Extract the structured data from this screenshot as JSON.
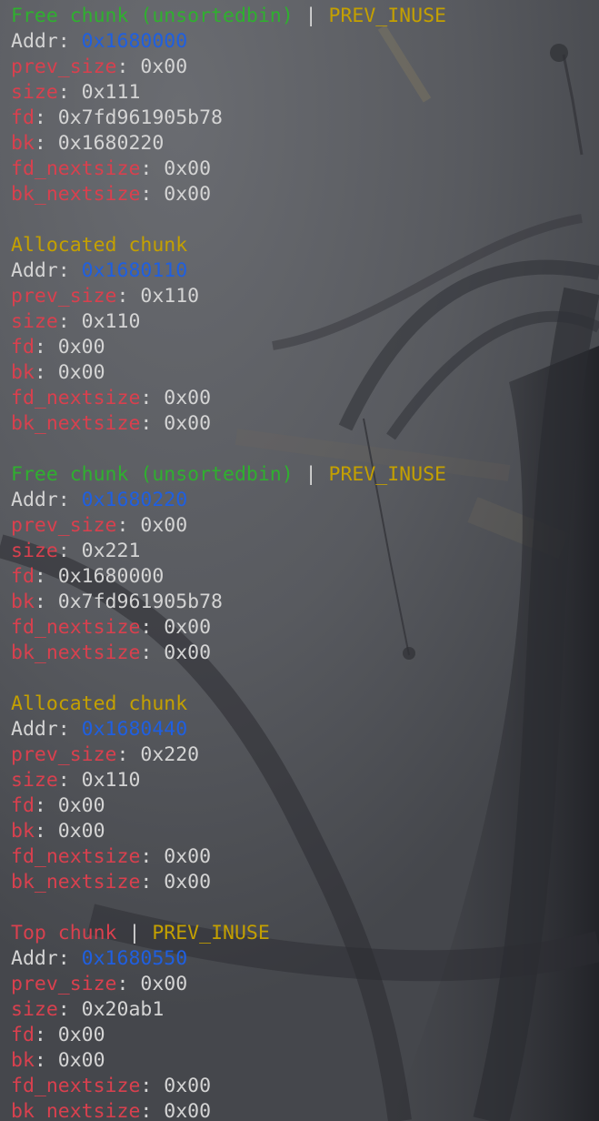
{
  "terminal": {
    "chunks": [
      {
        "header": "Free chunk (unsortedbin)",
        "flag": "PREV_INUSE",
        "kind": "free",
        "addr_label": "Addr",
        "addr": "0x1680000",
        "fields": [
          {
            "key": "prev_size",
            "value": "0x00"
          },
          {
            "key": "size",
            "value": "0x111"
          },
          {
            "key": "fd",
            "value": "0x7fd961905b78"
          },
          {
            "key": "bk",
            "value": "0x1680220"
          },
          {
            "key": "fd_nextsize",
            "value": "0x00"
          },
          {
            "key": "bk_nextsize",
            "value": "0x00"
          }
        ]
      },
      {
        "header": "Allocated chunk",
        "flag": "",
        "kind": "alloc",
        "addr_label": "Addr",
        "addr": "0x1680110",
        "fields": [
          {
            "key": "prev_size",
            "value": "0x110"
          },
          {
            "key": "size",
            "value": "0x110"
          },
          {
            "key": "fd",
            "value": "0x00"
          },
          {
            "key": "bk",
            "value": "0x00"
          },
          {
            "key": "fd_nextsize",
            "value": "0x00"
          },
          {
            "key": "bk_nextsize",
            "value": "0x00"
          }
        ]
      },
      {
        "header": "Free chunk (unsortedbin)",
        "flag": "PREV_INUSE",
        "kind": "free",
        "addr_label": "Addr",
        "addr": "0x1680220",
        "fields": [
          {
            "key": "prev_size",
            "value": "0x00"
          },
          {
            "key": "size",
            "value": "0x221"
          },
          {
            "key": "fd",
            "value": "0x1680000"
          },
          {
            "key": "bk",
            "value": "0x7fd961905b78"
          },
          {
            "key": "fd_nextsize",
            "value": "0x00"
          },
          {
            "key": "bk_nextsize",
            "value": "0x00"
          }
        ]
      },
      {
        "header": "Allocated chunk",
        "flag": "",
        "kind": "alloc",
        "addr_label": "Addr",
        "addr": "0x1680440",
        "fields": [
          {
            "key": "prev_size",
            "value": "0x220"
          },
          {
            "key": "size",
            "value": "0x110"
          },
          {
            "key": "fd",
            "value": "0x00"
          },
          {
            "key": "bk",
            "value": "0x00"
          },
          {
            "key": "fd_nextsize",
            "value": "0x00"
          },
          {
            "key": "bk_nextsize",
            "value": "0x00"
          }
        ]
      },
      {
        "header": "Top chunk",
        "flag": "PREV_INUSE",
        "kind": "top",
        "addr_label": "Addr",
        "addr": "0x1680550",
        "fields": [
          {
            "key": "prev_size",
            "value": "0x00"
          },
          {
            "key": "size",
            "value": "0x20ab1"
          },
          {
            "key": "fd",
            "value": "0x00"
          },
          {
            "key": "bk",
            "value": "0x00"
          },
          {
            "key": "fd_nextsize",
            "value": "0x00"
          },
          {
            "key": "bk_nextsize",
            "value": "0x00"
          }
        ]
      }
    ]
  },
  "colors": {
    "key": "#d9404e",
    "address": "#1f5fe0",
    "free_header": "#2fb02f",
    "allocated_header": "#c4a000",
    "top_header": "#d9404e",
    "flag": "#c4a000",
    "text": "#d4d4d4",
    "background": "#56585d"
  },
  "background_image": "anime-style wallpaper (dark-haired figure with flowing ribbons), dimmed behind terminal"
}
